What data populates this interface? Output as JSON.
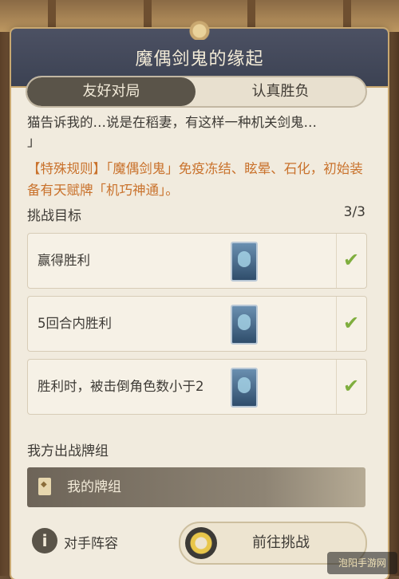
{
  "title": "魔偶剑鬼的缘起",
  "tabs": [
    {
      "label": "友好对局",
      "active": true
    },
    {
      "label": "认真胜负",
      "active": false
    }
  ],
  "description": {
    "line1": "猫告诉我的…说是在稻妻，有这样一种机关剑鬼…",
    "line2": "」"
  },
  "special_rule": "【特殊规则】「魔偶剑鬼」免疫冻结、眩晕、石化，初始装备有天赋牌「机巧神通」。",
  "goals": {
    "header": "挑战目标",
    "count": "3/3",
    "items": [
      {
        "label": "赢得胜利",
        "completed": true
      },
      {
        "label": "5回合内胜利",
        "completed": true
      },
      {
        "label": "胜利时，被击倒角色数小于2",
        "completed": true
      }
    ]
  },
  "deck": {
    "header": "我方出战牌组",
    "label": "我的牌组"
  },
  "opponent": {
    "icon_glyph": "i",
    "label": "对手阵容"
  },
  "go_button": {
    "label": "前往挑战"
  },
  "watermark": "泡阳手游网",
  "icons": {
    "check": "checkmark-icon",
    "card": "card-icon",
    "deck": "deck-icon",
    "info": "info-icon",
    "go": "target-icon"
  },
  "colors": {
    "accent_orange": "#c9722c",
    "check_green": "#7fae3e",
    "title_bar": "#4c5163"
  }
}
